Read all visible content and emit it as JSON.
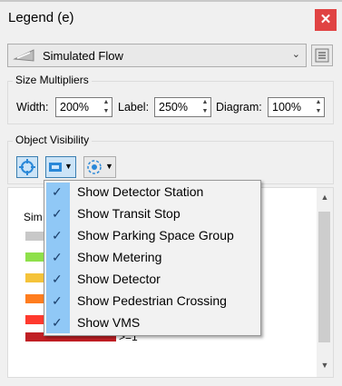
{
  "window": {
    "title": "Legend (e)",
    "close_glyph": "✕"
  },
  "flow_select": {
    "value": "Simulated Flow",
    "icon": "flow-icon"
  },
  "size_multipliers": {
    "title": "Size Multipliers",
    "width_label": "Width:",
    "width_value": "200%",
    "label_label": "Label:",
    "label_value": "250%",
    "diagram_label": "Diagram:",
    "diagram_value": "100%"
  },
  "object_visibility": {
    "title": "Object Visibility",
    "buttons": [
      "target-icon",
      "detector-icon",
      "node-icon"
    ]
  },
  "legend_panel": {
    "label": "Sim",
    "swatch_colors": [
      "#c8c8c8",
      "#8ee04a",
      "#f5c33a",
      "#ff7d1e",
      "#ff3a2e",
      "#c01f24"
    ],
    "last_value": ">=1"
  },
  "menu": {
    "items": [
      "Show Detector Station",
      "Show Transit Stop",
      "Show Parking Space Group",
      "Show Metering",
      "Show Detector",
      "Show Pedestrian Crossing",
      "Show VMS"
    ]
  },
  "colors": {
    "accent": "#90c8f6",
    "close": "#e04343"
  }
}
